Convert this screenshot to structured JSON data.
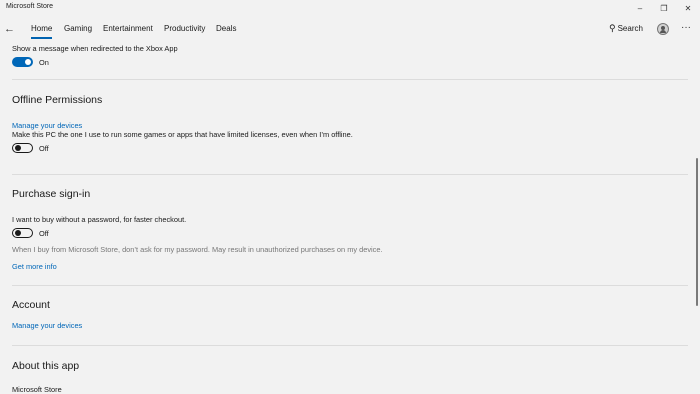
{
  "window": {
    "title": "Microsoft Store",
    "minimize": "–",
    "maximize": "❐",
    "close": "✕"
  },
  "nav": {
    "back": "←",
    "tabs": [
      "Home",
      "Gaming",
      "Entertainment",
      "Productivity",
      "Deals"
    ],
    "active_tab": "Home",
    "search_icon": "⚲",
    "search_label": "Search",
    "more": "···"
  },
  "sections": {
    "xbox": {
      "message": "Show a message when redirected to the Xbox App",
      "toggle_state": "On"
    },
    "offline": {
      "heading": "Offline Permissions",
      "link": "Manage your devices",
      "description": "Make this PC the one I use to run some games or apps that have limited licenses, even when I’m offline.",
      "toggle_state": "Off"
    },
    "purchase": {
      "heading": "Purchase sign-in",
      "description": "I want to buy without a password, for faster checkout.",
      "toggle_state": "Off",
      "note": "When I buy from Microsoft Store, don’t ask for my password. May result in unauthorized purchases on my device.",
      "link": "Get more info"
    },
    "account": {
      "heading": "Account",
      "link": "Manage your devices"
    },
    "about": {
      "heading": "About this app",
      "app_name": "Microsoft Store"
    }
  },
  "colors": {
    "accent": "#0067b8",
    "background": "#f2f2f2"
  }
}
